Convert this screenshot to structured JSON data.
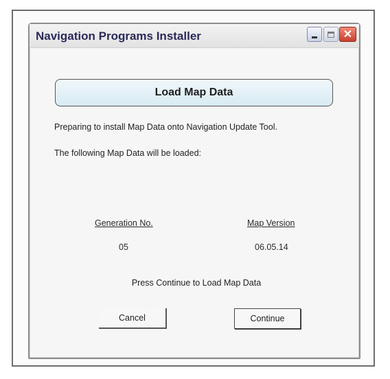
{
  "window": {
    "title": "Navigation Programs Installer",
    "buttons": {
      "minimize_icon": "minimize-icon",
      "maximize_icon": "maximize-icon",
      "close_icon": "close-icon",
      "close_glyph": "✕"
    }
  },
  "banner": {
    "title": "Load Map Data"
  },
  "messages": {
    "preparing": "Preparing to install Map Data onto Navigation Update Tool.",
    "following": "The following Map Data will be loaded:"
  },
  "map_data": {
    "generation_header": "Generation No.",
    "version_header": "Map Version",
    "generation_value": "05",
    "version_value": "06.05.14"
  },
  "instruction": "Press Continue to Load Map Data",
  "actions": {
    "cancel_label": "Cancel",
    "continue_label": "Continue"
  }
}
